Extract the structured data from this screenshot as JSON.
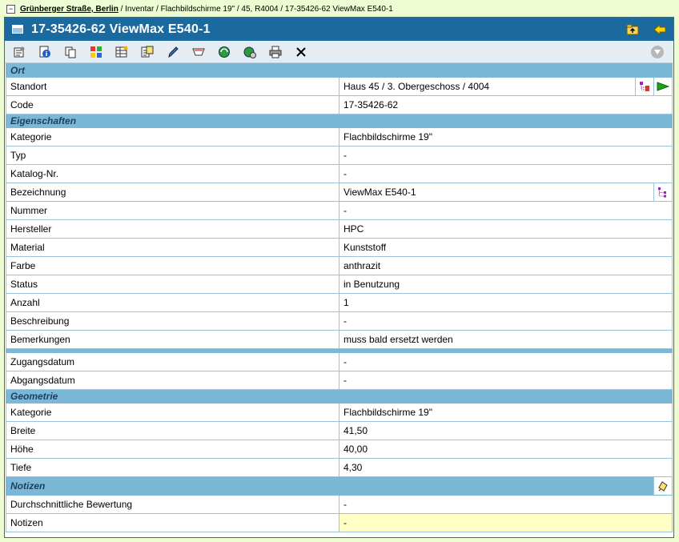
{
  "breadcrumb": {
    "collapse_symbol": "−",
    "link": "Grünberger Straße, Berlin",
    "path": " / Inventar / Flachbildschirme 19\" / 45, R4004 / 17-35426-62 ViewMax E540-1"
  },
  "header": {
    "title": "17-35426-62 ViewMax E540-1",
    "icons": [
      "window-icon",
      "folder-up-icon",
      "back-arrow-icon"
    ]
  },
  "toolbar": {
    "icons": [
      "properties-icon",
      "info-icon",
      "copy-icon",
      "grid-icon",
      "table-icon",
      "document-edit-icon",
      "pencil-icon",
      "tray-icon",
      "globe-refresh-icon",
      "globe-settings-icon",
      "print-icon",
      "close-icon",
      "dropdown-icon"
    ]
  },
  "sections": {
    "ort": "Ort",
    "eigenschaften": "Eigenschaften",
    "geometrie": "Geometrie",
    "notizen": "Notizen"
  },
  "ort": {
    "standort_label": "Standort",
    "standort_value": "Haus 45 / 3. Obergeschoss / 4004",
    "code_label": "Code",
    "code_value": "17-35426-62"
  },
  "eigenschaften": {
    "kategorie_label": "Kategorie",
    "kategorie_value": "Flachbildschirme 19\"",
    "typ_label": "Typ",
    "typ_value": "-",
    "katalog_label": "Katalog-Nr.",
    "katalog_value": "-",
    "bezeichnung_label": "Bezeichnung",
    "bezeichnung_value": "ViewMax E540-1",
    "nummer_label": "Nummer",
    "nummer_value": "-",
    "hersteller_label": "Hersteller",
    "hersteller_value": "HPC",
    "material_label": "Material",
    "material_value": "Kunststoff",
    "farbe_label": "Farbe",
    "farbe_value": "anthrazit",
    "status_label": "Status",
    "status_value": "in Benutzung",
    "anzahl_label": "Anzahl",
    "anzahl_value": "1",
    "beschreibung_label": "Beschreibung",
    "beschreibung_value": "-",
    "bemerkungen_label": "Bemerkungen",
    "bemerkungen_value": "muss bald ersetzt werden",
    "zugang_label": "Zugangsdatum",
    "zugang_value": "-",
    "abgang_label": "Abgangsdatum",
    "abgang_value": "-"
  },
  "geometrie": {
    "kategorie_label": "Kategorie",
    "kategorie_value": "Flachbildschirme 19\"",
    "breite_label": "Breite",
    "breite_value": "41,50",
    "hoehe_label": "Höhe",
    "hoehe_value": "40,00",
    "tiefe_label": "Tiefe",
    "tiefe_value": "4,30"
  },
  "notizen": {
    "bewertung_label": "Durchschnittliche Bewertung",
    "bewertung_value": "-",
    "notizen_label": "Notizen",
    "notizen_value": "-"
  },
  "colors": {
    "page_bg": "#eefcd4",
    "title_bar": "#1a6aa0",
    "section_bg": "#7bb7d6",
    "notes_bg": "#ffffc6"
  }
}
